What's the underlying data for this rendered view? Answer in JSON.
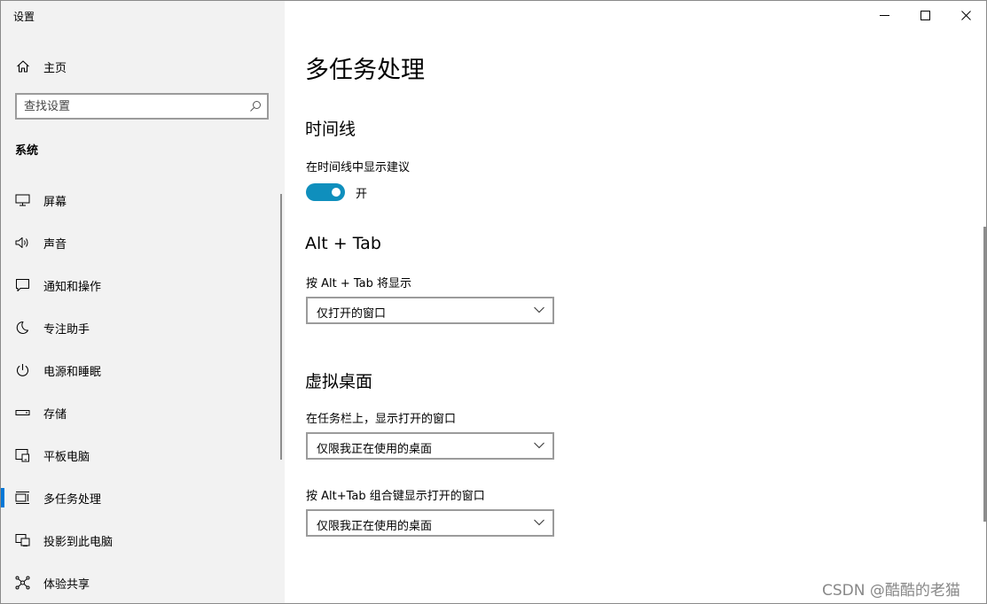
{
  "window": {
    "title": "设置"
  },
  "sidebar": {
    "home_label": "主页",
    "search_placeholder": "查找设置",
    "section": "系统",
    "items": [
      {
        "label": "屏幕",
        "icon": "monitor-icon"
      },
      {
        "label": "声音",
        "icon": "speaker-icon"
      },
      {
        "label": "通知和操作",
        "icon": "message-icon"
      },
      {
        "label": "专注助手",
        "icon": "moon-icon"
      },
      {
        "label": "电源和睡眠",
        "icon": "power-icon"
      },
      {
        "label": "存储",
        "icon": "storage-icon"
      },
      {
        "label": "平板电脑",
        "icon": "tablet-icon"
      },
      {
        "label": "多任务处理",
        "icon": "multitask-icon",
        "selected": true
      },
      {
        "label": "投影到此电脑",
        "icon": "projection-icon"
      },
      {
        "label": "体验共享",
        "icon": "share-icon"
      }
    ]
  },
  "main": {
    "title": "多任务处理",
    "timeline": {
      "heading": "时间线",
      "label": "在时间线中显示建议",
      "toggle_state": "开",
      "toggle_on": true
    },
    "alttab": {
      "heading": "Alt + Tab",
      "label": "按 Alt + Tab 将显示",
      "value": "仅打开的窗口"
    },
    "virtual_desktops": {
      "heading": "虚拟桌面",
      "taskbar_label": "在任务栏上，显示打开的窗口",
      "taskbar_value": "仅限我正在使用的桌面",
      "alttab_label": "按 Alt+Tab 组合键显示打开的窗口",
      "alttab_value": "仅限我正在使用的桌面"
    }
  },
  "watermark": "CSDN @酷酷的老猫",
  "colors": {
    "accent": "#0078d7",
    "toggle_on": "#0f8fbd",
    "sidebar_bg": "#f2f2f2"
  }
}
